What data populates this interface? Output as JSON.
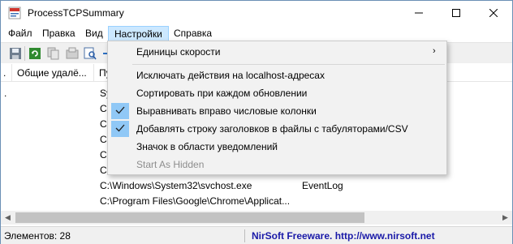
{
  "window": {
    "title": "ProcessTCPSummary",
    "minimize_glyph": "—",
    "maximize_glyph": "☐",
    "close_glyph": "✕"
  },
  "menubar": {
    "items": [
      {
        "label": "Файл"
      },
      {
        "label": "Правка"
      },
      {
        "label": "Вид"
      },
      {
        "label": "Настройки"
      },
      {
        "label": "Справка"
      }
    ],
    "active": "Настройки"
  },
  "toolbar": {
    "icons": [
      "save-icon",
      "refresh-icon",
      "copy-icon",
      "properties-icon",
      "find-icon",
      "arrow-icon"
    ]
  },
  "table": {
    "columns": [
      {
        "label": "."
      },
      {
        "label": "Общие удалё..."
      },
      {
        "label": "Пу"
      }
    ],
    "rows": [
      {
        "c0": ".",
        "c2": "Sy",
        "c3": ""
      },
      {
        "c0": "",
        "c2": "C:",
        "c3": ""
      },
      {
        "c0": "",
        "c2": "C:",
        "c3": ""
      },
      {
        "c0": "",
        "c2": "C:",
        "c3": ""
      },
      {
        "c0": "",
        "c2": "C:",
        "c3": ""
      },
      {
        "c0": "",
        "c2": "C:",
        "c3": ""
      },
      {
        "c0": "",
        "c2": "C:\\Windows\\System32\\svchost.exe",
        "c3": "EventLog"
      },
      {
        "c0": "",
        "c2": "C:\\Program Files\\Google\\Chrome\\Applicat...",
        "c3": ""
      }
    ]
  },
  "statusbar": {
    "count_label": "Элементов: 28",
    "link": "NirSoft Freeware.  http://www.nirsoft.net"
  },
  "dropdown": {
    "items": [
      {
        "label": "Единицы скорости",
        "submenu": true,
        "checked": false,
        "disabled": false
      },
      {
        "label": "Исключать действия на localhost-адресах",
        "checked": false,
        "disabled": false
      },
      {
        "label": "Сортировать при каждом обновлении",
        "checked": false,
        "disabled": false
      },
      {
        "label": "Выравнивать вправо числовые колонки",
        "checked": true,
        "disabled": false
      },
      {
        "label": "Добавлять строку заголовков в файлы с табуляторами/CSV",
        "checked": true,
        "disabled": false
      },
      {
        "label": "Значок в области уведомлений",
        "checked": false,
        "disabled": false
      },
      {
        "label": "Start As Hidden",
        "checked": false,
        "disabled": true
      }
    ],
    "submenu_arrow": "›"
  },
  "colors": {
    "menu_active_bg": "#cce8ff",
    "check_bg": "#90c8f6",
    "link": "#1a1aa8"
  }
}
